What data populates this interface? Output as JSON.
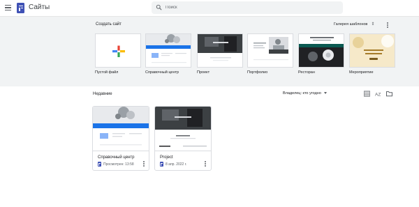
{
  "app": {
    "title": "Сайты",
    "menu_icon": "hamburger-menu-icon",
    "logo_icon": "google-sites-logo-icon"
  },
  "search": {
    "placeholder": "Поиск",
    "value": ""
  },
  "gallery": {
    "create_label": "Создать сайт",
    "toggle_label": "Галерея шаблонов",
    "templates": [
      {
        "label": "Пустой файл"
      },
      {
        "label": "Справочный центр"
      },
      {
        "label": "Проект"
      },
      {
        "label": "Портфолио"
      },
      {
        "label": "Ресторан"
      },
      {
        "label": "Мероприятие"
      }
    ]
  },
  "recent": {
    "title": "Недавние",
    "owner_filter": "Владелец: кто угодно",
    "cards": [
      {
        "name": "Справочный центр",
        "date": "Просмотрен: 13:58"
      },
      {
        "name": "Project",
        "date": "8 апр. 2022 г."
      }
    ]
  },
  "colors": {
    "accent": "#3f51b5",
    "gallery_bg": "#f1f3f4",
    "border": "#dadce0"
  }
}
